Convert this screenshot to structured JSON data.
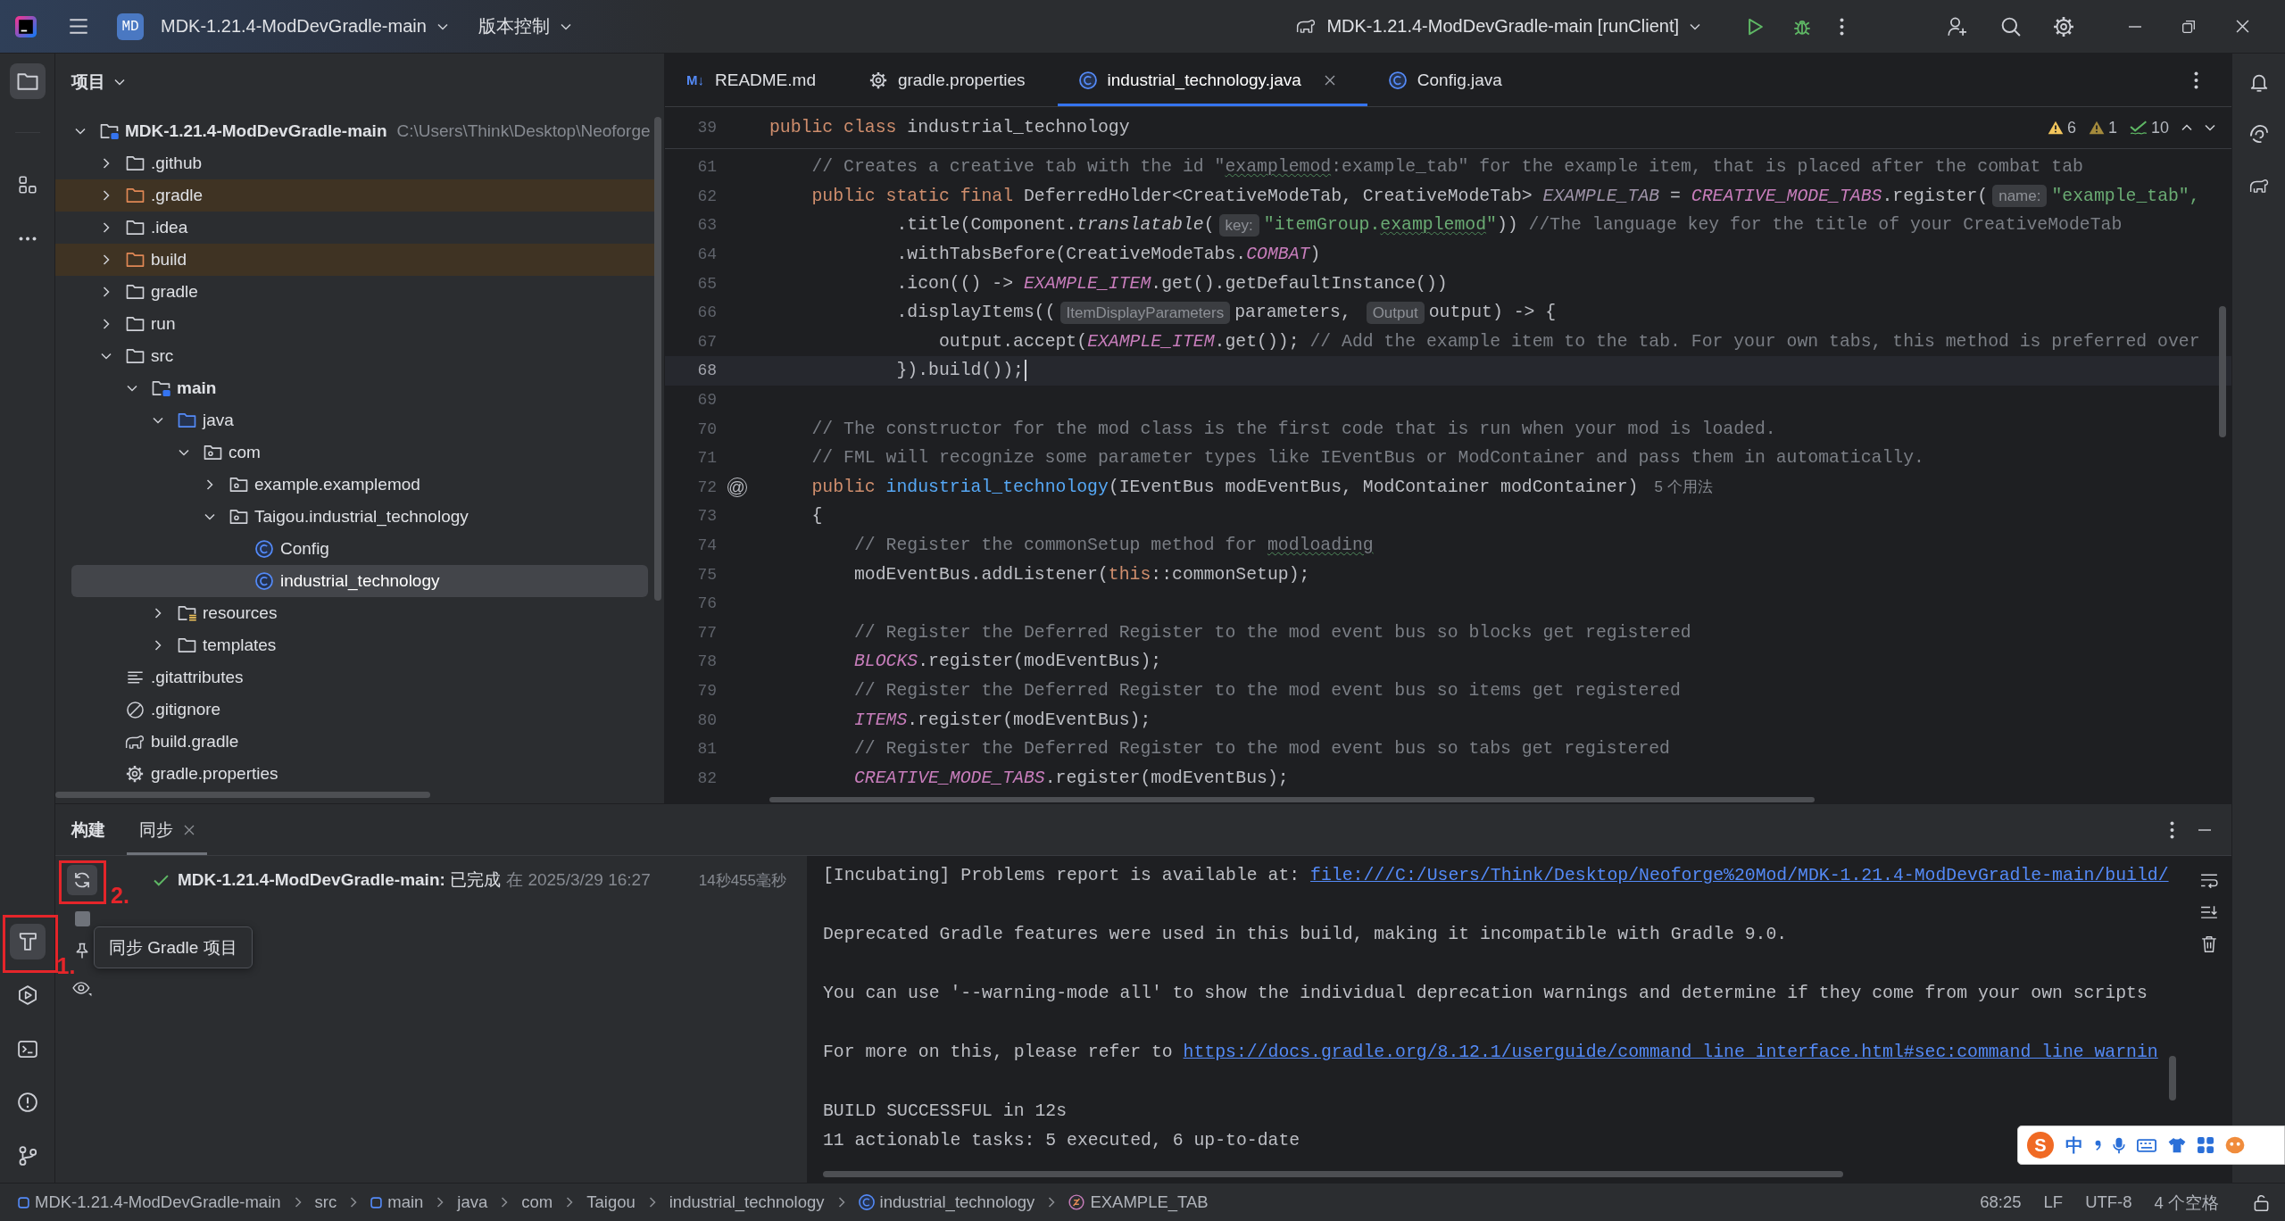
{
  "title_bar": {
    "project_badge": "MD",
    "project_name": "MDK-1.21.4-ModDevGradle-main",
    "vcs_menu": "版本控制",
    "run_configuration": "MDK-1.21.4-ModDevGradle-main [runClient]"
  },
  "left_toolbar": {
    "top": [
      {
        "kind": "project",
        "selected": true
      },
      {
        "kind": "structure",
        "selected": false
      },
      {
        "kind": "more",
        "selected": false
      }
    ],
    "bottom": [
      {
        "kind": "build",
        "selected": true,
        "callout": "1."
      },
      {
        "kind": "run",
        "selected": false
      },
      {
        "kind": "terminal",
        "selected": false
      },
      {
        "kind": "problems",
        "selected": false
      },
      {
        "kind": "git",
        "selected": false
      }
    ]
  },
  "project_panel": {
    "title": "项目",
    "tree": [
      {
        "name": "MDK-1.21.4-ModDevGradle-main",
        "path": "C:\\Users\\Think\\Desktop\\Neoforge",
        "kind": "module",
        "expanded": true,
        "selected": false,
        "children": [
          {
            "name": ".github",
            "kind": "folder",
            "expanded": false,
            "selected": false
          },
          {
            "name": ".gradle",
            "kind": "excluded",
            "expanded": false,
            "selected": false
          },
          {
            "name": ".idea",
            "kind": "folder",
            "expanded": false,
            "selected": false
          },
          {
            "name": "build",
            "kind": "excluded",
            "expanded": false,
            "selected": false
          },
          {
            "name": "gradle",
            "kind": "folder",
            "expanded": false,
            "selected": false
          },
          {
            "name": "run",
            "kind": "folder",
            "expanded": false,
            "selected": false
          },
          {
            "name": "src",
            "kind": "folder",
            "expanded": true,
            "selected": false,
            "children": [
              {
                "name": "main",
                "kind": "module",
                "expanded": true,
                "selected": false,
                "children": [
                  {
                    "name": "java",
                    "kind": "source",
                    "expanded": true,
                    "selected": false,
                    "children": [
                      {
                        "name": "com",
                        "kind": "package",
                        "expanded": true,
                        "selected": false,
                        "children": [
                          {
                            "name": "example.examplemod",
                            "kind": "package",
                            "expanded": false,
                            "selected": false
                          },
                          {
                            "name": "Taigou.industrial_technology",
                            "kind": "package",
                            "expanded": true,
                            "selected": false,
                            "children": [
                              {
                                "name": "Config",
                                "kind": "class",
                                "selected": false
                              },
                              {
                                "name": "industrial_technology",
                                "kind": "class",
                                "selected": true
                              }
                            ]
                          }
                        ]
                      }
                    ]
                  },
                  {
                    "name": "resources",
                    "kind": "resources",
                    "expanded": false,
                    "selected": false
                  },
                  {
                    "name": "templates",
                    "kind": "folder",
                    "expanded": false,
                    "selected": false
                  }
                ]
              }
            ]
          },
          {
            "name": ".gitattributes",
            "kind": "text",
            "selected": false
          },
          {
            "name": ".gitignore",
            "kind": "ignore",
            "selected": false
          },
          {
            "name": "build.gradle",
            "kind": "gradle",
            "selected": false
          },
          {
            "name": "gradle.properties",
            "kind": "properties",
            "selected": false
          }
        ]
      }
    ]
  },
  "editor": {
    "tabs": [
      {
        "label": "README.md",
        "kind": "markdown",
        "icon": "M↓",
        "selected": false
      },
      {
        "label": "gradle.properties",
        "kind": "properties",
        "selected": false
      },
      {
        "label": "industrial_technology.java",
        "kind": "class",
        "selected": true
      },
      {
        "label": "Config.java",
        "kind": "class",
        "selected": false
      }
    ],
    "sticky_line": {
      "number": "39",
      "tokens": [
        {
          "kind": "keyword",
          "text": "public class"
        },
        {
          "kind": "plain",
          "text": " industrial_technology"
        }
      ]
    },
    "inspections": [
      {
        "kind": "warning",
        "count": "6"
      },
      {
        "kind": "weak_warning",
        "count": "1"
      },
      {
        "kind": "typo",
        "count": "10"
      }
    ],
    "lines": [
      {
        "number": "61",
        "current": false,
        "tokens": [
          {
            "kind": "comment",
            "text": "    // Creates a creative tab with the id \""
          },
          {
            "kind": "comment_typo",
            "text": "examplemod"
          },
          {
            "kind": "comment",
            "text": ":example_tab\" for the example item, that is placed after the combat tab"
          }
        ]
      },
      {
        "number": "62",
        "current": false,
        "tokens": [
          {
            "kind": "keyword",
            "text": "    public static final"
          },
          {
            "kind": "plain",
            "text": " DeferredHolder<CreativeModeTab, CreativeModeTab> "
          },
          {
            "kind": "unused",
            "text": "EXAMPLE_TAB"
          },
          {
            "kind": "plain",
            "text": " = "
          },
          {
            "kind": "field",
            "text": "CREATIVE_MODE_TABS"
          },
          {
            "kind": "plain",
            "text": ".register("
          },
          {
            "kind": "hint",
            "text": "name:"
          },
          {
            "kind": "string",
            "text": "\"example_tab\","
          }
        ]
      },
      {
        "number": "63",
        "current": false,
        "tokens": [
          {
            "kind": "plain",
            "text": "            .title(Component."
          },
          {
            "kind": "static_call",
            "text": "translatable"
          },
          {
            "kind": "plain",
            "text": "("
          },
          {
            "kind": "hint",
            "text": "key:"
          },
          {
            "kind": "string",
            "text": "\"itemGroup."
          },
          {
            "kind": "string_typo",
            "text": "examplemod"
          },
          {
            "kind": "string",
            "text": "\""
          },
          {
            "kind": "plain",
            "text": "))"
          },
          {
            "kind": "comment",
            "text": " //The language key for the title of your CreativeModeTab"
          }
        ]
      },
      {
        "number": "64",
        "current": false,
        "tokens": [
          {
            "kind": "plain",
            "text": "            .withTabsBefore(CreativeModeTabs."
          },
          {
            "kind": "field",
            "text": "COMBAT"
          },
          {
            "kind": "plain",
            "text": ")"
          }
        ]
      },
      {
        "number": "65",
        "current": false,
        "tokens": [
          {
            "kind": "plain",
            "text": "            .icon(() -> "
          },
          {
            "kind": "field",
            "text": "EXAMPLE_ITEM"
          },
          {
            "kind": "plain",
            "text": ".get().getDefaultInstance())"
          }
        ]
      },
      {
        "number": "66",
        "current": false,
        "tokens": [
          {
            "kind": "plain",
            "text": "            .displayItems(("
          },
          {
            "kind": "hint",
            "text": "ItemDisplayParameters"
          },
          {
            "kind": "plain",
            "text": "parameters, "
          },
          {
            "kind": "hint",
            "text": "Output"
          },
          {
            "kind": "plain",
            "text": "output) -> {"
          }
        ]
      },
      {
        "number": "67",
        "current": false,
        "tokens": [
          {
            "kind": "plain",
            "text": "                output.accept("
          },
          {
            "kind": "field",
            "text": "EXAMPLE_ITEM"
          },
          {
            "kind": "plain",
            "text": ".get());"
          },
          {
            "kind": "comment",
            "text": " // Add the example item to the tab. For your own tabs, this method is preferred over"
          }
        ]
      },
      {
        "number": "68",
        "current": true,
        "tokens": [
          {
            "kind": "plain",
            "text": "            }).build());"
          }
        ]
      },
      {
        "number": "69",
        "current": false
      },
      {
        "number": "70",
        "current": false,
        "tokens": [
          {
            "kind": "comment",
            "text": "    // The constructor for the mod class is the first code that is run when your mod is loaded."
          }
        ]
      },
      {
        "number": "71",
        "current": false,
        "tokens": [
          {
            "kind": "comment",
            "text": "    // FML will recognize some parameter types like IEventBus or ModContainer and pass them in automatically."
          }
        ]
      },
      {
        "number": "72",
        "current": false,
        "gutter_mark": "@",
        "tokens": [
          {
            "kind": "keyword",
            "text": "    public "
          },
          {
            "kind": "method",
            "text": "industrial_technology"
          },
          {
            "kind": "plain",
            "text": "(IEventBus modEventBus, ModContainer modContainer)"
          },
          {
            "kind": "usages",
            "text": "5 个用法"
          }
        ]
      },
      {
        "number": "73",
        "current": false,
        "tokens": [
          {
            "kind": "plain",
            "text": "    {"
          }
        ]
      },
      {
        "number": "74",
        "current": false,
        "tokens": [
          {
            "kind": "comment",
            "text": "        // Register the commonSetup method for "
          },
          {
            "kind": "comment_typo",
            "text": "modloading"
          }
        ]
      },
      {
        "number": "75",
        "current": false,
        "tokens": [
          {
            "kind": "plain",
            "text": "        modEventBus.addListener("
          },
          {
            "kind": "keyword",
            "text": "this"
          },
          {
            "kind": "plain",
            "text": "::commonSetup);"
          }
        ]
      },
      {
        "number": "76",
        "current": false
      },
      {
        "number": "77",
        "current": false,
        "tokens": [
          {
            "kind": "comment",
            "text": "        // Register the Deferred Register to the mod event bus so blocks get registered"
          }
        ]
      },
      {
        "number": "78",
        "current": false,
        "tokens": [
          {
            "kind": "field",
            "text": "        BLOCKS"
          },
          {
            "kind": "plain",
            "text": ".register(modEventBus);"
          }
        ]
      },
      {
        "number": "79",
        "current": false,
        "tokens": [
          {
            "kind": "comment",
            "text": "        // Register the Deferred Register to the mod event bus so items get registered"
          }
        ]
      },
      {
        "number": "80",
        "current": false,
        "tokens": [
          {
            "kind": "field",
            "text": "        ITEMS"
          },
          {
            "kind": "plain",
            "text": ".register(modEventBus);"
          }
        ]
      },
      {
        "number": "81",
        "current": false,
        "tokens": [
          {
            "kind": "comment",
            "text": "        // Register the Deferred Register to the mod event bus so tabs get registered"
          }
        ]
      },
      {
        "number": "82",
        "current": false,
        "tokens": [
          {
            "kind": "field",
            "text": "        CREATIVE_MODE_TABS"
          },
          {
            "kind": "plain",
            "text": ".register(modEventBus);"
          }
        ]
      }
    ]
  },
  "bottom_panel": {
    "title": "构建",
    "tabs": [
      {
        "label": "同步",
        "selected": true
      }
    ],
    "tools": [
      {
        "kind": "sync",
        "disabled": false,
        "callout": "2."
      },
      {
        "kind": "stop",
        "disabled": true
      },
      {
        "kind": "pin",
        "disabled": false
      },
      {
        "kind": "watch",
        "disabled": false
      }
    ],
    "tooltip": "同步 Gradle 项目",
    "build_tree": [
      {
        "kind": "success",
        "label": "**MDK-1.21.4-ModDevGradle-main:** 已完成",
        "time": "在 2025/3/29 16:27",
        "duration": "14秒455毫秒"
      }
    ],
    "console": [
      [
        {
          "text": "[Incubating] Problems report is available at: ",
          "link": "file:///C:/Users/Think/Desktop/Neoforge%20Mod/MDK-1.21.4-ModDevGradle-main/build/"
        }
      ],
      [
        {
          "text": "Deprecated Gradle features were used in this build, making it incompatible with Gradle 9.0."
        }
      ],
      [
        {
          "text": "You can use '--warning-mode all' to show the individual deprecation warnings and determine if they come from your own scripts"
        }
      ],
      [
        {
          "text": "For more on this, please refer to ",
          "link": "https://docs.gradle.org/8.12.1/userguide/command_line_interface.html#sec:command_line_warnin"
        }
      ],
      [
        {
          "text": "BUILD SUCCESSFUL in 12s"
        },
        {
          "text": "11 actionable tasks: 5 executed, 6 up-to-date"
        }
      ]
    ]
  },
  "status_bar": {
    "breadcrumbs": [
      {
        "label": "MDK-1.21.4-ModDevGradle-main",
        "kind": "module"
      },
      {
        "label": "src",
        "kind": "plain"
      },
      {
        "label": "main",
        "kind": "module"
      },
      {
        "label": "java",
        "kind": "plain"
      },
      {
        "label": "com",
        "kind": "plain"
      },
      {
        "label": "Taigou",
        "kind": "plain"
      },
      {
        "label": "industrial_technology",
        "kind": "plain"
      },
      {
        "label": "industrial_technology",
        "kind": "class"
      },
      {
        "label": "EXAMPLE_TAB",
        "kind": "field"
      }
    ],
    "caret_position": "68:25",
    "line_separator": "LF",
    "encoding": "UTF-8",
    "indent": "4 个空格"
  },
  "ime_bar": {
    "logo": "S",
    "mode": "中"
  }
}
